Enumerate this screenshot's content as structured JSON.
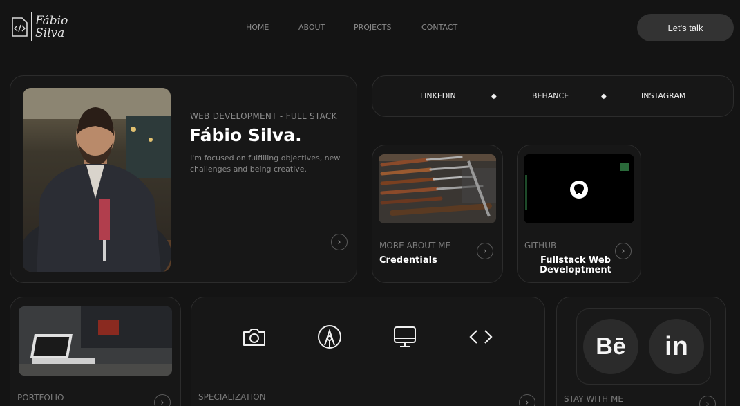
{
  "brand": {
    "line1": "Fábio",
    "line2": "Silva"
  },
  "nav": [
    "HOME",
    "ABOUT",
    "PROJECTS",
    "CONTACT"
  ],
  "cta": "Let's talk",
  "hero": {
    "subtitle": "WEB DEVELOPMENT - FULL STACK",
    "name": "Fábio Silva.",
    "description": "I'm focused on fulfilling objectives, new challenges and being creative."
  },
  "social": [
    "LINKEDIN",
    "BEHANCE",
    "INSTAGRAM"
  ],
  "credentials": {
    "label": "MORE ABOUT ME",
    "title": "Credentials"
  },
  "github": {
    "label": "GITHUB",
    "title_line1": "Fullstack Web",
    "title_line2": "Developtment"
  },
  "portfolio": {
    "label": "PORTFOLIO"
  },
  "specialization": {
    "label": "SPECIALIZATION",
    "icons": [
      "camera-icon",
      "pen-nib-icon",
      "monitor-icon",
      "code-icon"
    ]
  },
  "stay": {
    "label": "STAY WITH ME",
    "behance": "Bē",
    "linkedin": "in"
  },
  "colors": {
    "background": "#141414",
    "card": "#171717",
    "border": "#2c2c2c",
    "accent_button": "#333333"
  }
}
